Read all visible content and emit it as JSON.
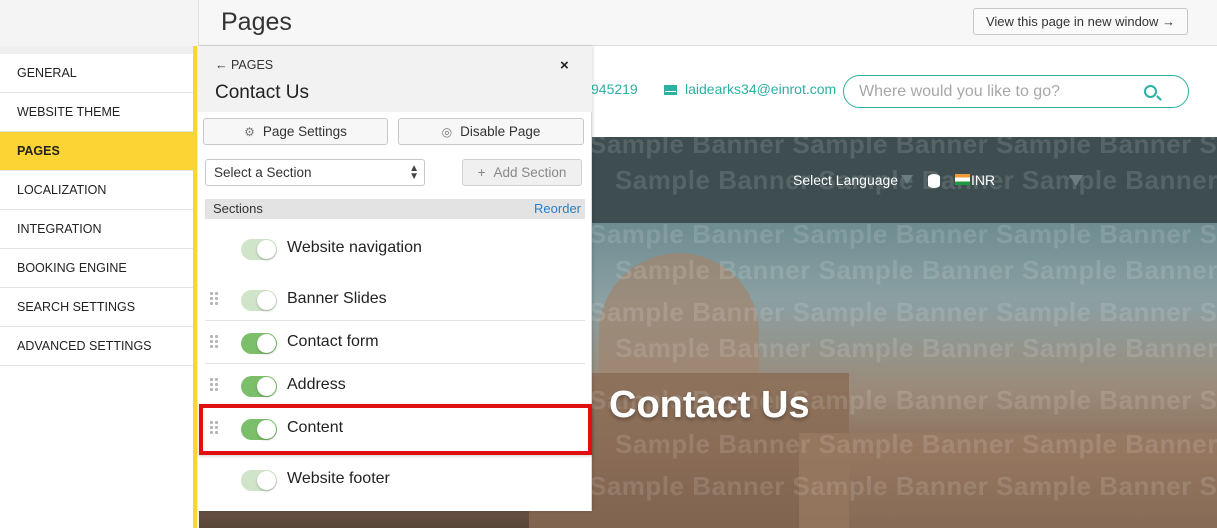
{
  "header": {
    "title": "Pages",
    "view_button": "View this page in new window →"
  },
  "leftnav": {
    "items": [
      {
        "label": "GENERAL"
      },
      {
        "label": "WEBSITE THEME"
      },
      {
        "label": "PAGES",
        "active": true
      },
      {
        "label": "LOCALIZATION"
      },
      {
        "label": "INTEGRATION"
      },
      {
        "label": "BOOKING ENGINE"
      },
      {
        "label": "SEARCH SETTINGS"
      },
      {
        "label": "ADVANCED SETTINGS"
      }
    ]
  },
  "panel": {
    "back_label": "← PAGES",
    "close_label": "×",
    "title": "Contact Us",
    "page_settings_label": "Page Settings",
    "disable_page_label": "Disable Page",
    "select_section_value": "Select a Section",
    "add_section_label": "Add Section",
    "sections_label": "Sections",
    "reorder_label": "Reorder",
    "sections": [
      {
        "label": "Website navigation",
        "enabled": true,
        "draggable": false
      },
      {
        "label": "Banner Slides",
        "enabled": true,
        "draggable": true
      },
      {
        "label": "Contact form",
        "enabled": true,
        "draggable": true
      },
      {
        "label": "Address",
        "enabled": true,
        "draggable": true
      },
      {
        "label": "Content",
        "enabled": true,
        "draggable": true,
        "highlighted": true
      },
      {
        "label": "Website footer",
        "enabled": true,
        "draggable": false
      }
    ]
  },
  "preview": {
    "phone_partial": "945219",
    "email": "laidearks34@einrot.com",
    "search_placeholder": "Where would you like to go?",
    "language_label": "Select Language",
    "currency": "INR",
    "hero_title": "Contact Us",
    "watermark_text": "Sample Banner Sample Banner Sample Banner Sample Banner Sample Banner Sample Banner"
  },
  "colors": {
    "accent_yellow": "#fcd535",
    "teal": "#2bb0a2",
    "toggle_green": "#7cbf6b",
    "highlight_red": "#e01010",
    "nav_dark": "#3d4d50"
  }
}
